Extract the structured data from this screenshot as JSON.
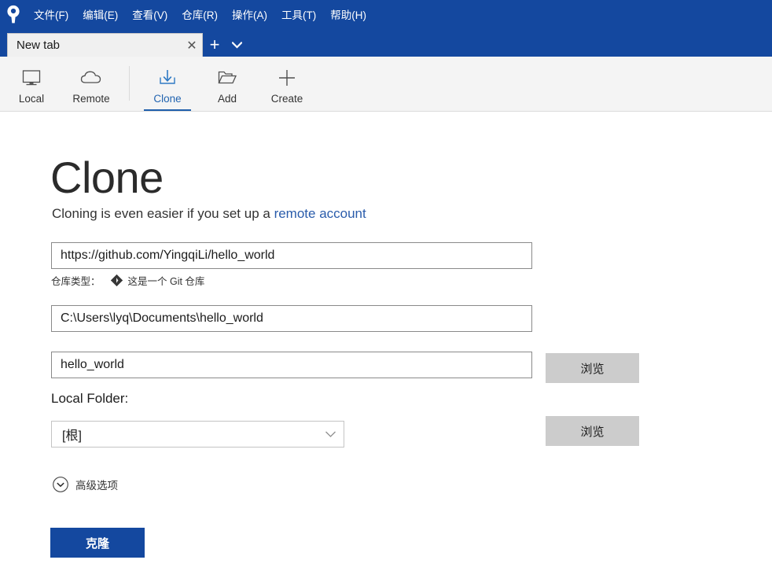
{
  "window": {
    "logo_icon": "sourcetree-logo-icon",
    "accent_blue": "#14489f",
    "link_blue": "#2a5cab"
  },
  "menubar": {
    "items": [
      {
        "label": "文件(F)",
        "name": "menu-file"
      },
      {
        "label": "编辑(E)",
        "name": "menu-edit"
      },
      {
        "label": "查看(V)",
        "name": "menu-view"
      },
      {
        "label": "仓库(R)",
        "name": "menu-repository"
      },
      {
        "label": "操作(A)",
        "name": "menu-actions"
      },
      {
        "label": "工具(T)",
        "name": "menu-tools"
      },
      {
        "label": "帮助(H)",
        "name": "menu-help"
      }
    ]
  },
  "tabs": {
    "active_tab_label": "New tab",
    "close_glyph": "✕",
    "add_glyph": "+",
    "dropdown_glyph": "▾"
  },
  "toolbar": {
    "buttons": [
      {
        "label": "Local",
        "icon": "monitor-icon",
        "active": false
      },
      {
        "label": "Remote",
        "icon": "cloud-icon",
        "active": false
      },
      {
        "label": "Clone",
        "icon": "download-arrow-icon",
        "active": true
      },
      {
        "label": "Add",
        "icon": "folder-open-icon",
        "active": false
      },
      {
        "label": "Create",
        "icon": "plus-icon",
        "active": false
      }
    ]
  },
  "main": {
    "title": "Clone",
    "subtitle_prefix": "Cloning is even easier if you set up a ",
    "subtitle_link": "remote account",
    "source_url": {
      "value": "https://github.com/YingqiLi/hello_world",
      "placeholder": "",
      "browse_label": "浏览"
    },
    "repo_type": {
      "label": "仓库类型：",
      "icon": "git-diamond-icon",
      "value": "这是一个 Git 仓库"
    },
    "destination_path": {
      "value": "C:\\Users\\lyq\\Documents\\hello_world",
      "placeholder": "",
      "browse_label": "浏览"
    },
    "repo_name": {
      "value": "hello_world",
      "placeholder": ""
    },
    "local_folder": {
      "label": "Local Folder:",
      "selected": "[根]",
      "caret_icon": "chevron-down-icon"
    },
    "advanced_options": {
      "label": "高级选项",
      "icon": "chevron-down-circle-icon"
    },
    "clone_button_label": "克隆"
  }
}
